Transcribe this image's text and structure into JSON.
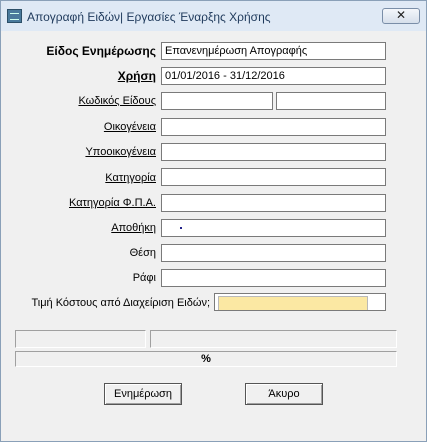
{
  "window": {
    "title": "Απογραφή Ειδών| Εργασίες Έναρξης Χρήσης",
    "close_label": "✕"
  },
  "form": {
    "update_type": {
      "label": "Είδος Ενημέρωσης",
      "value": "Επανενημέρωση Απογραφής"
    },
    "fiscal_year": {
      "label": "Χρήση",
      "value": "01/01/2016 - 31/12/2016"
    },
    "item_code": {
      "label": "Κωδικός Είδους",
      "from": "",
      "to": ""
    },
    "family": {
      "label": "Οικογένεια",
      "value": ""
    },
    "subfamily": {
      "label": "Υποοικογένεια",
      "value": ""
    },
    "category": {
      "label": "Κατηγορία",
      "value": ""
    },
    "vat_category": {
      "label": "Κατηγορία Φ.Π.Α.",
      "value": ""
    },
    "warehouse": {
      "label": "Αποθήκη",
      "value": ""
    },
    "position": {
      "label": "Θέση",
      "value": ""
    },
    "shelf": {
      "label": "Ράφι",
      "value": ""
    },
    "cost_price": {
      "label": "Τιμή Κόστους από Διαχείριση Ειδών;",
      "value": ""
    }
  },
  "progress": {
    "status_left": "",
    "status_right": "",
    "percent_label": "%",
    "percent": 0
  },
  "buttons": {
    "update": "Ενημέρωση",
    "cancel": "Άκυρο"
  },
  "colors": {
    "titlebar": "#dfe9f5",
    "window_bg": "#f0f0f0",
    "highlight_field": "#fbe8a3"
  }
}
